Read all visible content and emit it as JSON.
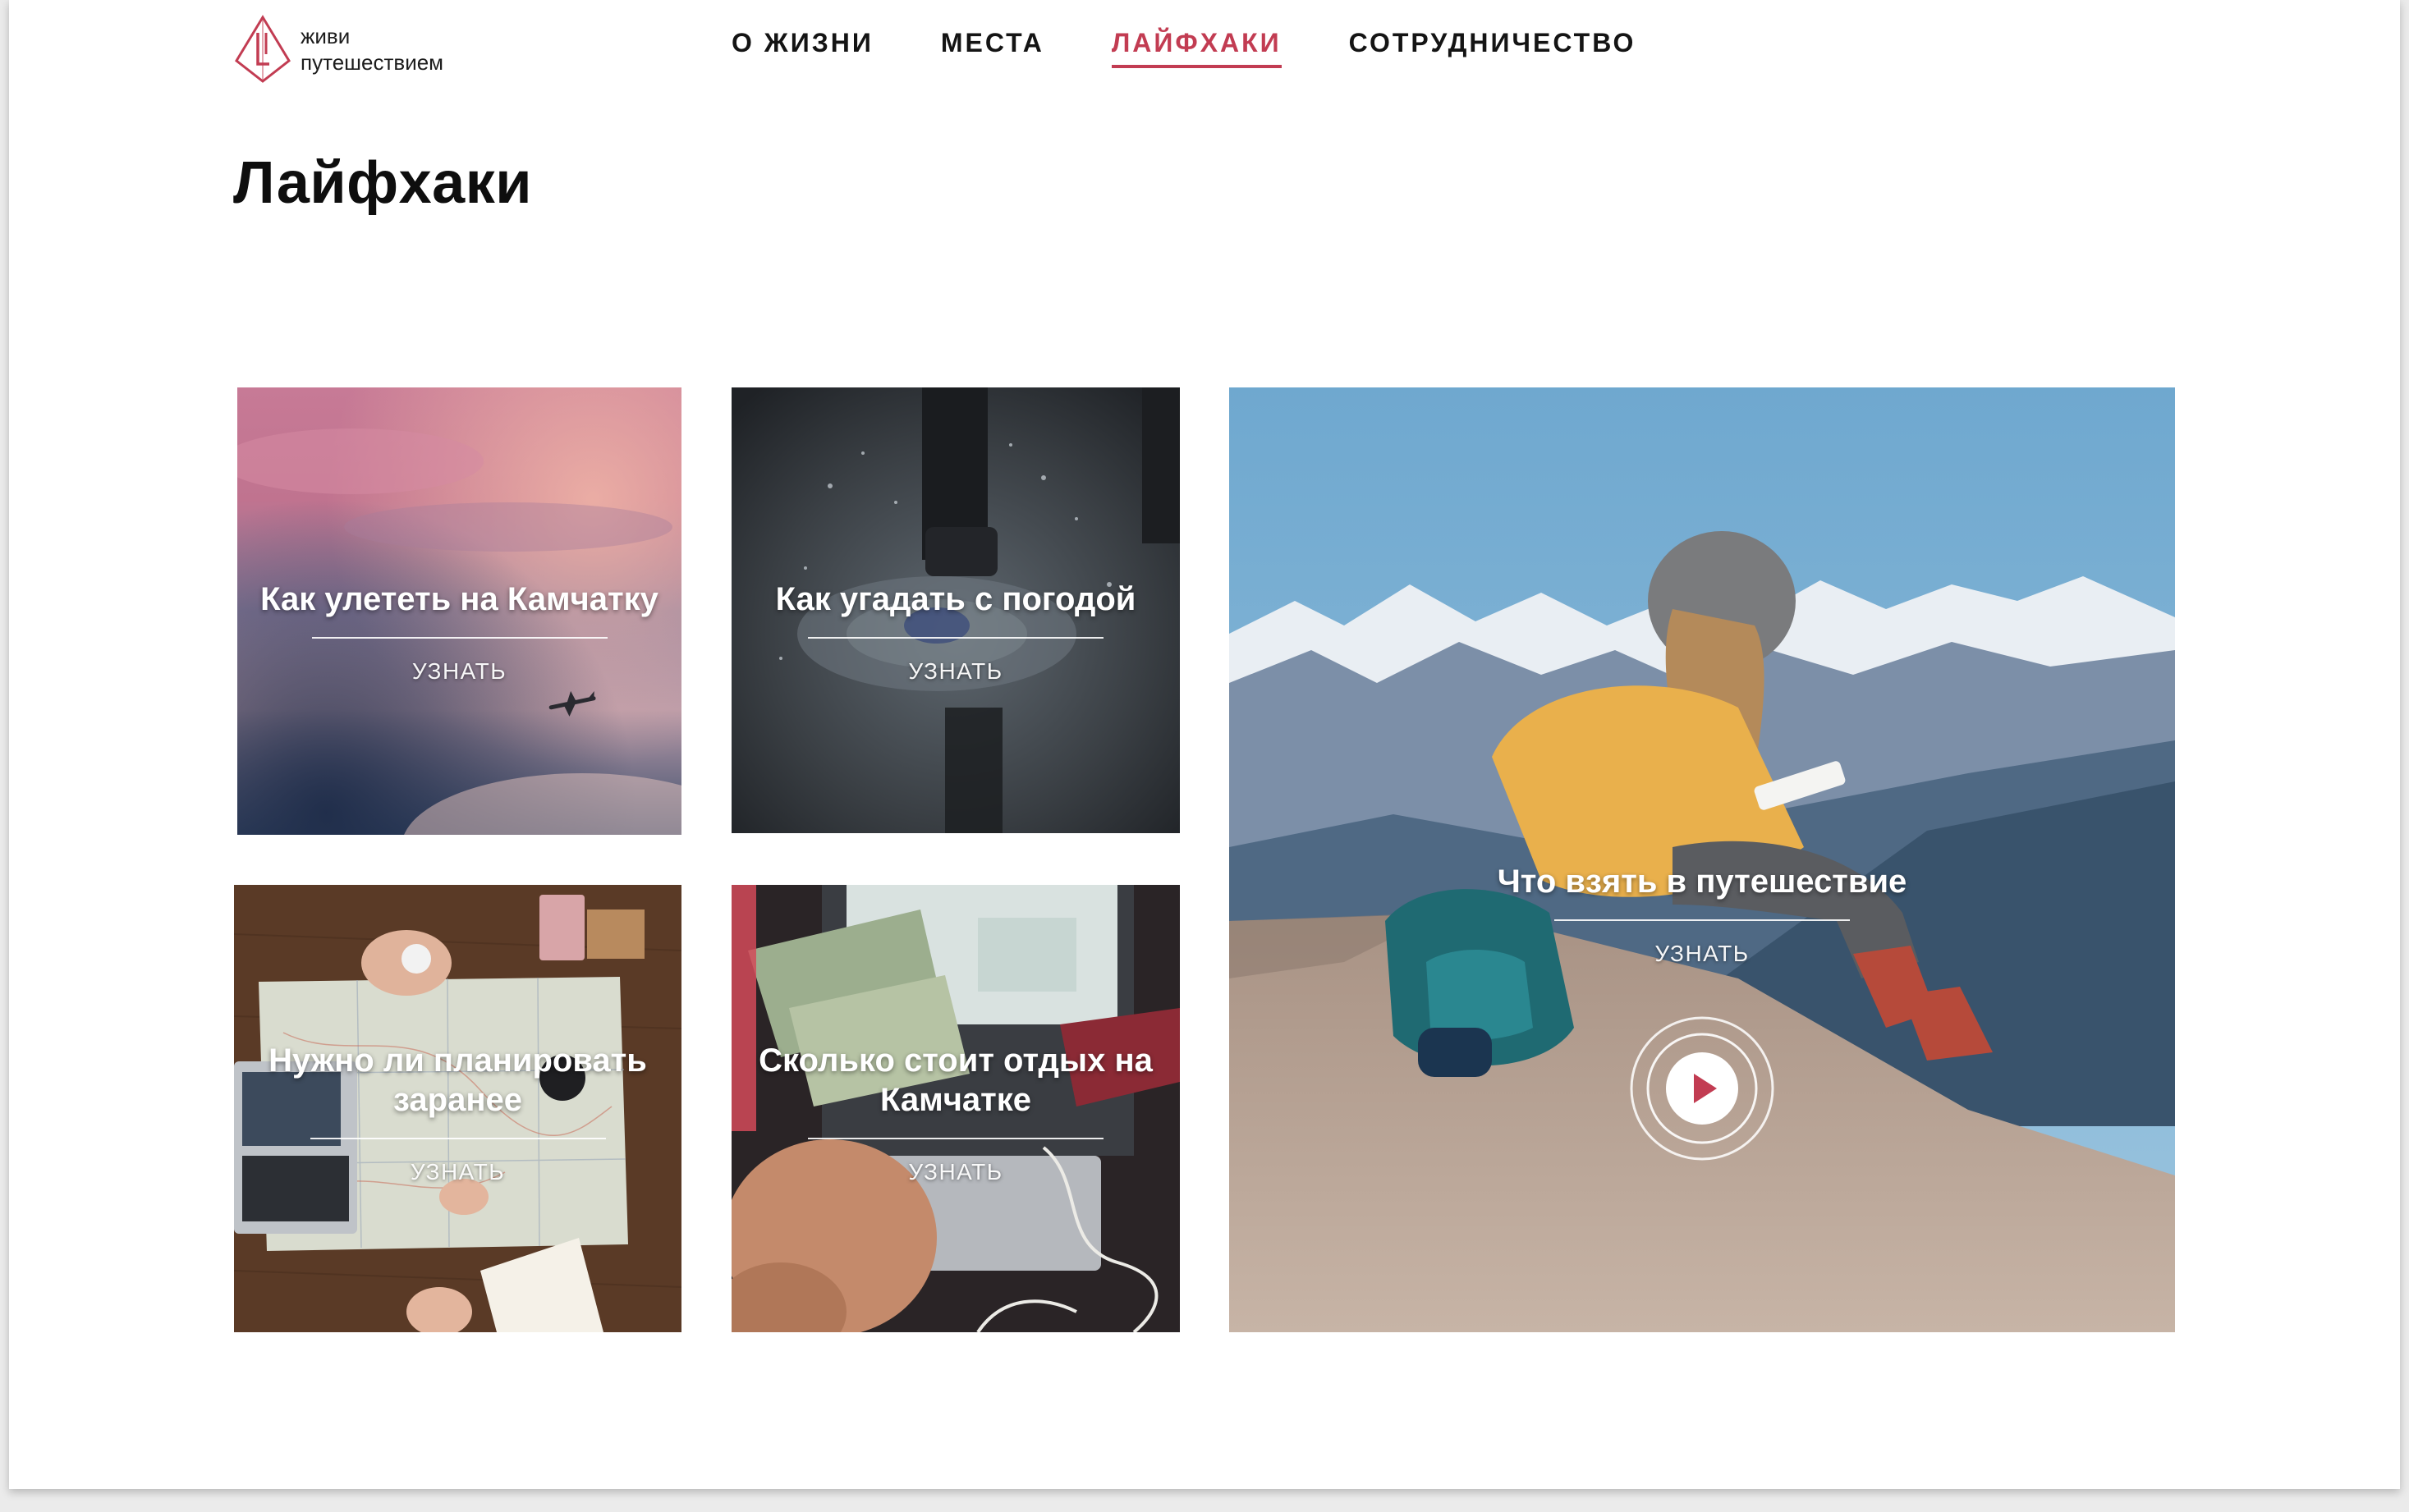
{
  "logo": {
    "line1": "живи",
    "line2": "путешествием",
    "accent_color": "#c23c52"
  },
  "nav": {
    "items": [
      {
        "label": "О ЖИЗНИ",
        "active": false
      },
      {
        "label": "МЕСТА",
        "active": false
      },
      {
        "label": "ЛАЙФХАКИ",
        "active": true
      },
      {
        "label": "СОТРУДНИЧЕСТВО",
        "active": false
      }
    ]
  },
  "page": {
    "title": "Лайфхаки"
  },
  "cards": [
    {
      "title": "Как улететь на Камчатку",
      "link": "УЗНАТЬ",
      "image": "pink-sky-with-airplane"
    },
    {
      "title": "Как угадать с погодой",
      "link": "УЗНАТЬ",
      "image": "boots-splashing-puddle"
    },
    {
      "title": "Нужно ли планировать заранее",
      "link": "УЗНАТЬ",
      "image": "map-on-wooden-table"
    },
    {
      "title": "Сколько стоит отдых на Камчатке",
      "link": "УЗНАТЬ",
      "image": "dollars-and-passport"
    },
    {
      "title": "Что взять в путешествие",
      "link": "УЗНАТЬ",
      "image": "hiker-on-mountain",
      "play_icon": "play-icon"
    }
  ],
  "colors": {
    "accent": "#c23c52",
    "text": "#141414",
    "background": "#ffffff"
  }
}
